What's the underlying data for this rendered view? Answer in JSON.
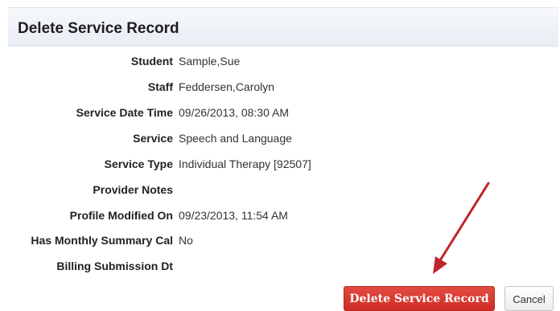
{
  "dialog": {
    "title": "Delete Service Record"
  },
  "fields": [
    {
      "label": "Student",
      "value": "Sample,Sue"
    },
    {
      "label": "Staff",
      "value": "Feddersen,Carolyn"
    },
    {
      "label": "Service Date Time",
      "value": "09/26/2013, 08:30 AM"
    },
    {
      "label": "Service",
      "value": "Speech and Language"
    },
    {
      "label": "Service Type",
      "value": "Individual Therapy [92507]"
    },
    {
      "label": "Provider Notes",
      "value": ""
    },
    {
      "label": "Profile Modified On",
      "value": "09/23/2013, 11:54 AM"
    },
    {
      "label": "Has Monthly Summary Cal",
      "value": "No"
    },
    {
      "label": "Billing Submission Dt",
      "value": ""
    }
  ],
  "actions": {
    "delete_label": "Delete Service Record",
    "cancel_label": "Cancel"
  },
  "colors": {
    "delete_button": "#d9362d",
    "annotation_arrow": "#c0242b",
    "header_background": "#eef2f7"
  },
  "icons": {
    "annotation": "red-arrow-icon"
  }
}
